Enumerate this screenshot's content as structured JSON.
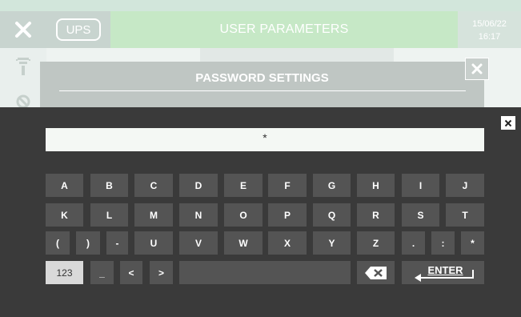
{
  "header": {
    "close_icon": "close-x-icon",
    "ups_label": "UPS",
    "title": "USER PARAMETERS",
    "date": "15/06/22",
    "time": "16:17"
  },
  "sidebar": {
    "icons": [
      "filter-icon",
      "ban-icon"
    ]
  },
  "dialog": {
    "title": "PASSWORD SETTINGS",
    "close_icon": "close-x-icon"
  },
  "keyboard": {
    "close_icon": "close-x-icon",
    "input_value": "*",
    "row1": [
      "A",
      "B",
      "C",
      "D",
      "E",
      "F",
      "G",
      "H",
      "I",
      "J"
    ],
    "row2": [
      "K",
      "L",
      "M",
      "N",
      "O",
      "P",
      "Q",
      "R",
      "S",
      "T"
    ],
    "row3": [
      "(",
      ")",
      "-",
      "U",
      "V",
      "W",
      "X",
      "Y",
      "Z",
      ".",
      ":",
      "*"
    ],
    "row4": {
      "mode": "123",
      "underscore": "_",
      "left": "<",
      "right": ">",
      "space": "",
      "backspace_icon": "backspace-icon",
      "enter": "ENTER"
    }
  }
}
